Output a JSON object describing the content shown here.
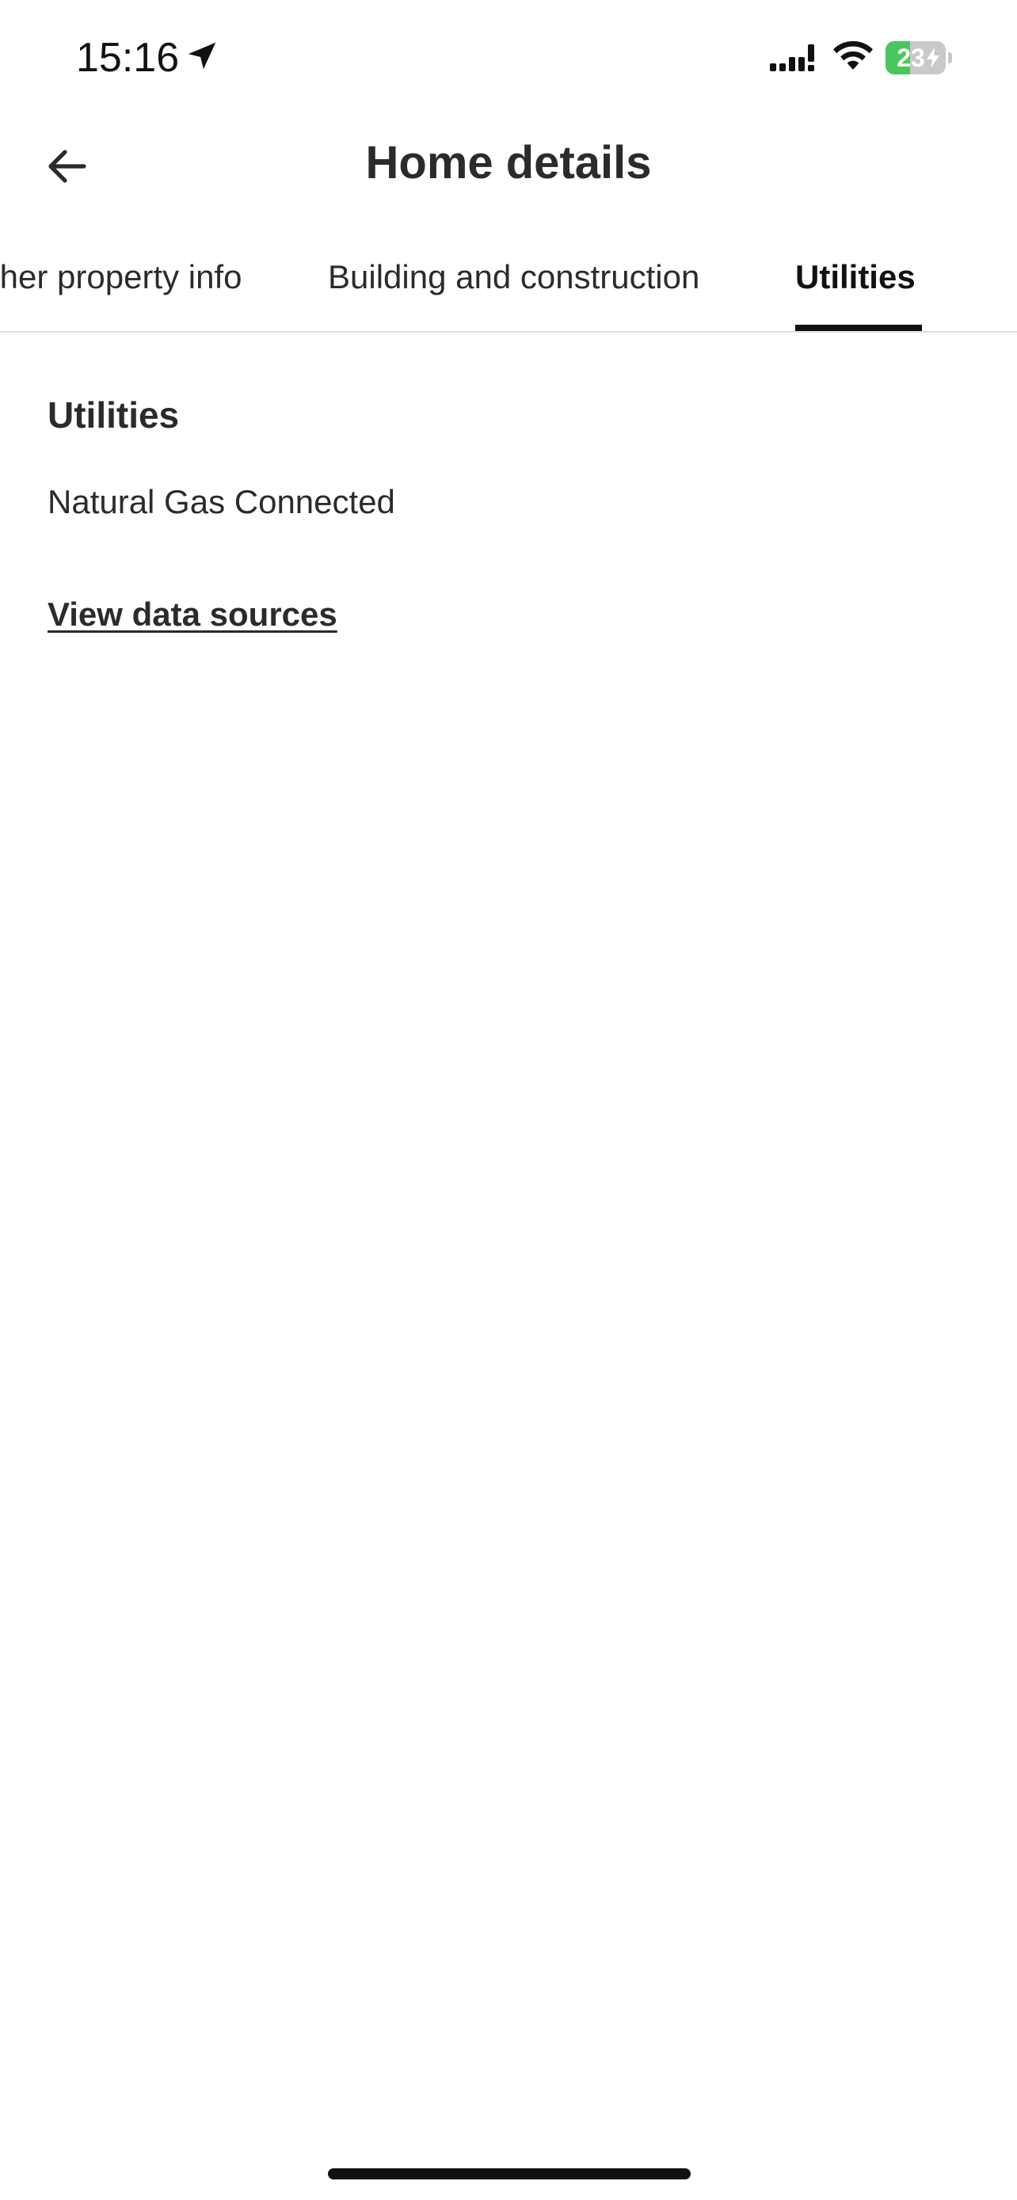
{
  "status_bar": {
    "time": "15:16",
    "battery_level": "23",
    "battery_percent": 23,
    "battery_fill_color": "#4cc75e",
    "icons": [
      "location-arrow-icon",
      "cellular-signal-icon",
      "wifi-icon",
      "battery-icon",
      "charging-bolt-icon"
    ]
  },
  "header": {
    "title": "Home details",
    "back_icon": "arrow-left-icon"
  },
  "tabs": {
    "items": [
      {
        "label": "ther property info",
        "active": false
      },
      {
        "label": "Building and construction",
        "active": false
      },
      {
        "label": "Utilities",
        "active": true
      }
    ]
  },
  "content": {
    "section_title": "Utilities",
    "utility_value": "Natural Gas Connected",
    "link_label": "View data sources"
  }
}
